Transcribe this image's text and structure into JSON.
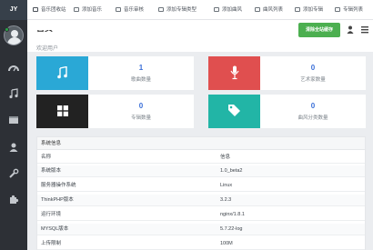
{
  "brand": "JY",
  "tabs": [
    "音乐团收站",
    "添加音乐",
    "音乐审核",
    "添加专辑类型",
    "添加曲风",
    "曲风列表",
    "添加专辑",
    "专辑列表"
  ],
  "header": {
    "title": "首页",
    "subtitle": "欢迎用户",
    "clear_cache_label": "清除全站缓存"
  },
  "stats": [
    {
      "value": "1",
      "label": "歌曲数量",
      "color": "#2aa8d6",
      "icon": "music-note-icon"
    },
    {
      "value": "0",
      "label": "艺术家数量",
      "color": "#e04f4f",
      "icon": "microphone-icon"
    },
    {
      "value": "0",
      "label": "专辑数量",
      "color": "#222222",
      "icon": "grid-icon"
    },
    {
      "value": "0",
      "label": "曲风分类数量",
      "color": "#22b5a6",
      "icon": "tags-icon"
    }
  ],
  "system_info": {
    "title": "系统信息",
    "header_name": "名称",
    "header_value": "信息",
    "rows": [
      {
        "name": "系统版本",
        "value": "1.0_beta2"
      },
      {
        "name": "服务器操作系统",
        "value": "Linux"
      },
      {
        "name": "ThinkPHP版本",
        "value": "3.2.3"
      },
      {
        "name": "运行环境",
        "value": "nginx/1.8.1"
      },
      {
        "name": "MYSQL版本",
        "value": "5.7.22-log"
      },
      {
        "name": "上传限制",
        "value": "100M"
      }
    ]
  }
}
